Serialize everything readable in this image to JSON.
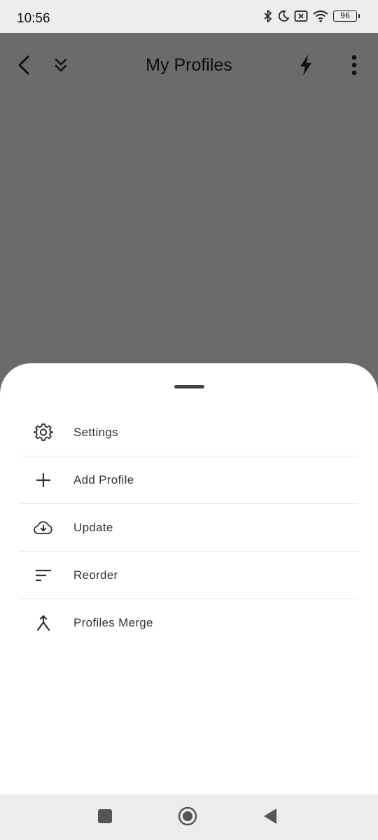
{
  "status_bar": {
    "time": "10:56",
    "battery": "96",
    "icons": [
      "bluetooth-icon",
      "moon-icon",
      "no-sim-icon",
      "wifi-icon",
      "battery-icon"
    ]
  },
  "app_bar": {
    "title": "My Profiles",
    "icons": [
      "back-icon",
      "collapse-icon",
      "flash-icon",
      "more-vertical-icon"
    ]
  },
  "sheet": {
    "items": [
      {
        "label": "Settings",
        "icon": "gear-icon"
      },
      {
        "label": "Add Profile",
        "icon": "plus-icon"
      },
      {
        "label": "Update",
        "icon": "cloud-download-icon"
      },
      {
        "label": "Reorder",
        "icon": "sort-icon"
      },
      {
        "label": "Profiles Merge",
        "icon": "merge-icon"
      }
    ]
  },
  "nav_bar": {
    "icons": [
      "recents-icon",
      "home-icon",
      "back-triangle-icon"
    ]
  },
  "colors": {
    "scrim": "#6b6b6b",
    "sheet": "#ffffff",
    "status_bg": "#ececec",
    "text": "#333333"
  }
}
